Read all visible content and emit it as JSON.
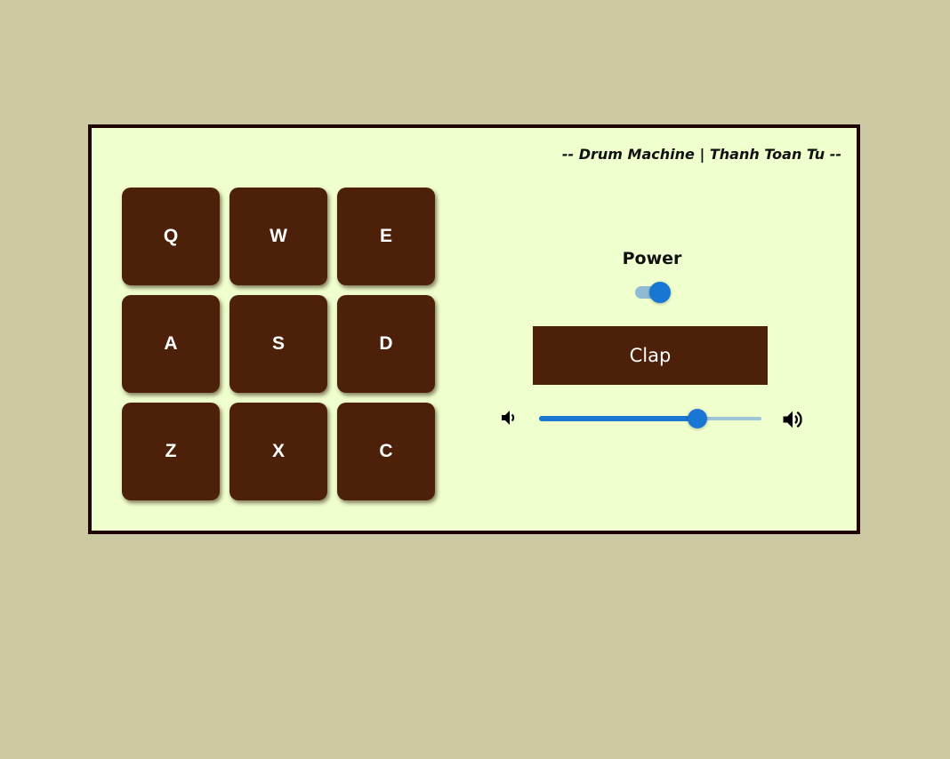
{
  "header": {
    "title": "-- Drum Machine | Thanh Toan Tu --"
  },
  "pads": [
    {
      "key": "Q"
    },
    {
      "key": "W"
    },
    {
      "key": "E"
    },
    {
      "key": "A"
    },
    {
      "key": "S"
    },
    {
      "key": "D"
    },
    {
      "key": "Z"
    },
    {
      "key": "X"
    },
    {
      "key": "C"
    }
  ],
  "controls": {
    "power_label": "Power",
    "power_on": true,
    "display_text": "Clap",
    "volume": 0.71,
    "volume_down_icon": "volume-down-icon",
    "volume_up_icon": "volume-up-icon"
  },
  "colors": {
    "page_bg": "#cdc9a3",
    "panel_bg": "#f0ffce",
    "panel_border": "#1e0500",
    "pad_bg": "#4d2009",
    "accent": "#1976d2",
    "track": "#9ec4d8"
  }
}
